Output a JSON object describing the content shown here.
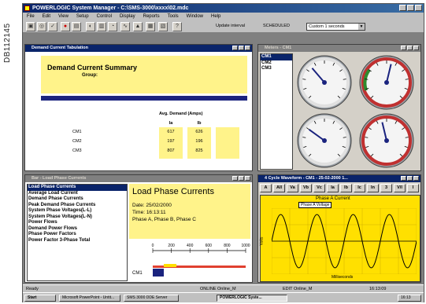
{
  "doc_code": "DB112145",
  "app": {
    "title": "POWERLOGIC System Manager - C:\\SMS-3000\\xxxx\\02.mdc"
  },
  "menu": [
    "File",
    "Edit",
    "View",
    "Setup",
    "Control",
    "Display",
    "Reports",
    "Tools",
    "Window",
    "Help"
  ],
  "toolbar": {
    "update_label": "Update interval",
    "scheduled_label": "SCHEDULED",
    "combo_value": "Custom 1 seconds"
  },
  "demand": {
    "title": "Demand Current Tabulation",
    "heading": "Demand Current Summary",
    "group_label": "Group:",
    "table_header": "Avg. Demand (Amps)",
    "columns": [
      "Ia",
      "Ib"
    ],
    "rows": [
      {
        "name": "CM1",
        "ia": "617",
        "ib": "626"
      },
      {
        "name": "CM2",
        "ia": "197",
        "ib": "196"
      },
      {
        "name": "CM3",
        "ia": "807",
        "ib": "825"
      }
    ]
  },
  "meters": {
    "title": "Meters - CM1",
    "items": [
      "CM1",
      "CM2",
      "CM3"
    ]
  },
  "load": {
    "title": "Bar - Load Phase Currents",
    "items": [
      "Load Phase Currents",
      "Average Load Current",
      "Demand Phase Currents",
      "Peak Demand Phase Currents",
      "System Phase Voltages(L-L)",
      "System Phase Voltages(L-N)",
      "Power Flows",
      "Demand Power Flows",
      "Phase Power Factors",
      "Power Factor 3-Phase Total"
    ],
    "panel_title": "Load Phase Currents",
    "date": "Date: 25/02/2000",
    "time": "Time: 16:13:11",
    "phases": "Phase A, Phase B, Phase C",
    "bar_label": "CM1",
    "scale": [
      "0",
      "200",
      "400",
      "600",
      "800",
      "1000"
    ]
  },
  "wave": {
    "title": "4 Cycle Waveform - CM1 - 25-02-2000 1...",
    "buttons": [
      "A",
      "All",
      "Va",
      "Vb",
      "Vc",
      "Ia",
      "Ib",
      "Ic",
      "In",
      "3",
      "V/I",
      "I"
    ],
    "chart_title": "Phase A Current",
    "legend": "Phase A Voltage",
    "ylabel": "Volts",
    "xlabel": "Milliseconds"
  },
  "status": {
    "left": "Ready",
    "online": "ONLINE  Online_M",
    "edit": "EDIT  Online_M",
    "time": "16:13:09"
  },
  "taskbar": [
    "Start",
    "Microsoft PowerPoint - Untit...",
    "SMS 3000 DDE Server",
    "POWERLOGIC Syste..."
  ],
  "tray_time": "16:13",
  "colors": {
    "titlebar": "#0a246a",
    "panel_yellow": "#fff38a",
    "wave_bg": "#ffe000",
    "navy": "#1a237e"
  }
}
